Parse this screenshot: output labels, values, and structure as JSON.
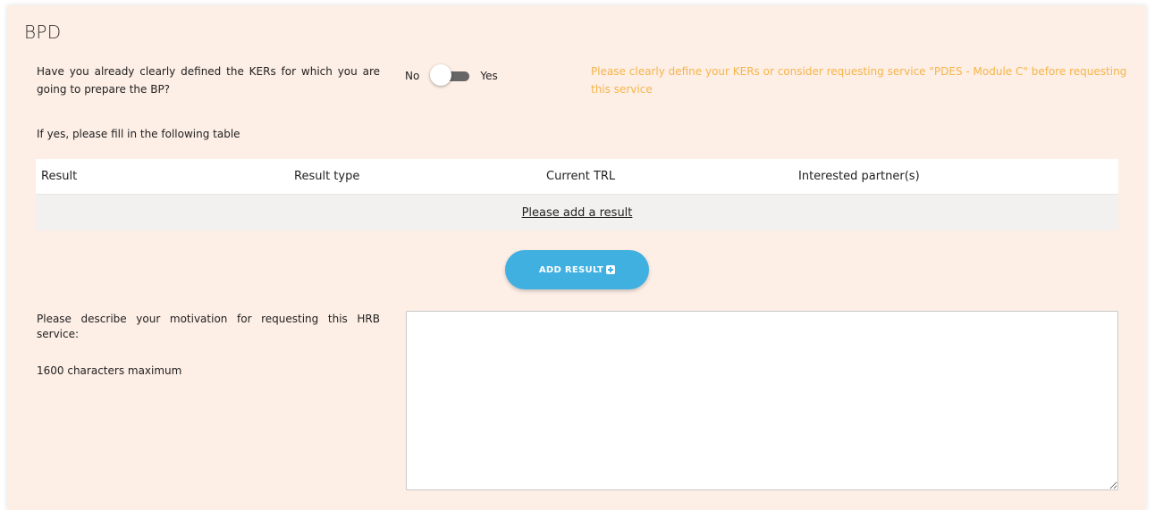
{
  "section": {
    "title": "BPD"
  },
  "ker_question": {
    "text": "Have you already clearly defined the KERs for which you are going to prepare the BP?",
    "toggle_no_label": "No",
    "toggle_yes_label": "Yes",
    "toggle_state": "off",
    "warning": "Please clearly define your KERs or consider requesting service \"PDES - Module C\" before requesting this service"
  },
  "table": {
    "note": "If yes, please fill in the following table",
    "columns": [
      "Result",
      "Result type",
      "Current TRL",
      "Interested partner(s)"
    ],
    "empty_link": "Please add a result"
  },
  "add_button": {
    "label": "ADD RESULT",
    "icon": "plus-square-icon"
  },
  "motivation": {
    "label": "Please describe your motivation for requesting this HRB service:",
    "limit": "1600 characters maximum",
    "value": "",
    "placeholder": ""
  },
  "colors": {
    "panel_bg": "#fdeee6",
    "warning_text": "#f5b54a",
    "button_bg": "#3fb0e0",
    "toggle_track": "#666666"
  }
}
